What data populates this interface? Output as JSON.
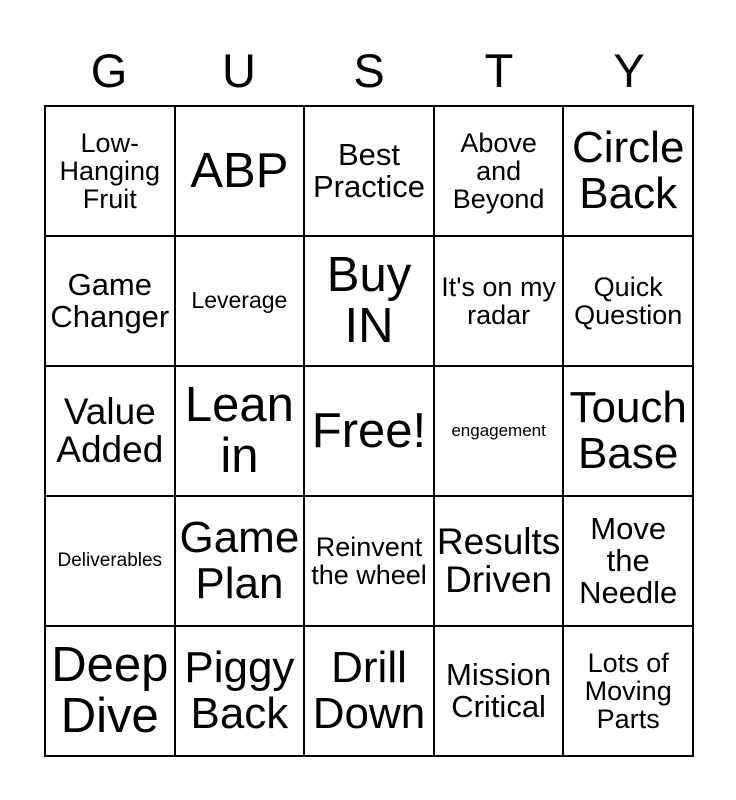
{
  "card": {
    "title_letters": [
      "G",
      "U",
      "S",
      "T",
      "Y"
    ],
    "columns": 5,
    "rows": 5,
    "colors": {
      "background": "#ffffff",
      "border": "#000000",
      "text": "#000000"
    }
  },
  "grid": {
    "rows": [
      {
        "cells": [
          {
            "text": "Low-Hanging Fruit",
            "size": "fs-s"
          },
          {
            "text": "ABP",
            "size": "fs-xxl"
          },
          {
            "text": "Best Practice",
            "size": "fs-m"
          },
          {
            "text": "Above and Beyond",
            "size": "fs-s"
          },
          {
            "text": "Circle Back",
            "size": "fs-xl"
          }
        ]
      },
      {
        "cells": [
          {
            "text": "Game Changer",
            "size": "fs-m"
          },
          {
            "text": "Leverage",
            "size": "fs-xs"
          },
          {
            "text": "Buy IN",
            "size": "fs-xxl"
          },
          {
            "text": "It's on my radar",
            "size": "fs-s"
          },
          {
            "text": "Quick Question",
            "size": "fs-s"
          }
        ]
      },
      {
        "cells": [
          {
            "text": "Value Added",
            "size": "fs-l"
          },
          {
            "text": "Lean in",
            "size": "fs-xxl"
          },
          {
            "text": "Free!",
            "size": "fs-xxl"
          },
          {
            "text": "engagement",
            "size": "fs-tiny"
          },
          {
            "text": "Touch Base",
            "size": "fs-xl"
          }
        ]
      },
      {
        "cells": [
          {
            "text": "Deliverables",
            "size": "fs-xxs"
          },
          {
            "text": "Game Plan",
            "size": "fs-xl"
          },
          {
            "text": "Reinvent the wheel",
            "size": "fs-s"
          },
          {
            "text": "Results Driven",
            "size": "fs-l"
          },
          {
            "text": "Move the Needle",
            "size": "fs-m"
          }
        ]
      },
      {
        "cells": [
          {
            "text": "Deep Dive",
            "size": "fs-xxl"
          },
          {
            "text": "Piggy Back",
            "size": "fs-xl"
          },
          {
            "text": "Drill Down",
            "size": "fs-xl"
          },
          {
            "text": "Mission Critical",
            "size": "fs-m"
          },
          {
            "text": "Lots of Moving Parts",
            "size": "fs-s"
          }
        ]
      }
    ]
  }
}
